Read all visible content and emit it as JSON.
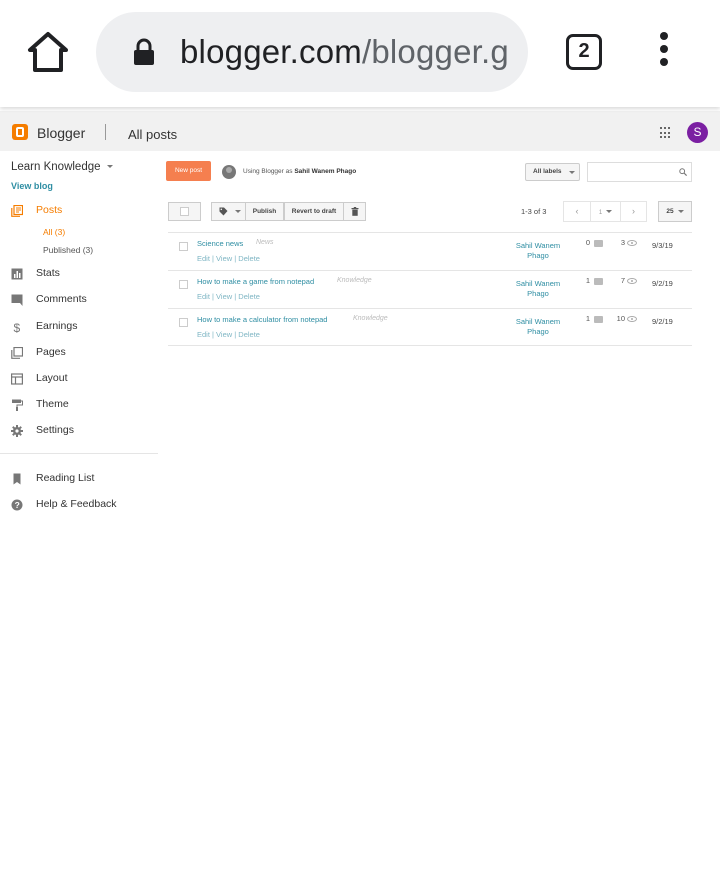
{
  "browser": {
    "url_host": "blogger.com",
    "url_path": "/blogger.g",
    "tab_count": "2"
  },
  "header": {
    "brand": "Blogger",
    "section": "All posts",
    "avatar_letter": "S"
  },
  "sidebar": {
    "blog_name": "Learn Knowledge",
    "view_blog": "View blog",
    "posts_label": "Posts",
    "sub_all": "All (3)",
    "sub_published": "Published (3)",
    "items": [
      {
        "label": "Stats",
        "icon": "stats-icon"
      },
      {
        "label": "Comments",
        "icon": "comment-icon"
      },
      {
        "label": "Earnings",
        "icon": "dollar-icon"
      },
      {
        "label": "Pages",
        "icon": "pages-icon"
      },
      {
        "label": "Layout",
        "icon": "layout-icon"
      },
      {
        "label": "Theme",
        "icon": "paint-roller-icon"
      },
      {
        "label": "Settings",
        "icon": "gear-icon"
      }
    ],
    "bottom_items": [
      {
        "label": "Reading List",
        "icon": "bookmark-icon"
      },
      {
        "label": "Help & Feedback",
        "icon": "help-icon"
      }
    ]
  },
  "main": {
    "new_post": "New post",
    "using_as_prefix": "Using Blogger as",
    "using_as_name": "Sahil Wanem Phago",
    "labels_select": "All labels",
    "toolbar": {
      "publish": "Publish",
      "revert": "Revert to draft"
    },
    "pager": {
      "range": "1-3 of 3",
      "page": "1",
      "per_page": "25"
    },
    "posts": [
      {
        "title": "Science news",
        "label": "News",
        "actions": "Edit | View | Delete",
        "author_1": "Sahil Wanem",
        "author_2": "Phago",
        "comments": "0",
        "views": "3",
        "date": "9/3/19"
      },
      {
        "title": "How to make a game from notepad",
        "label": "Knowledge",
        "actions": "Edit | View | Delete",
        "author_1": "Sahil Wanem",
        "author_2": "Phago",
        "comments": "1",
        "views": "7",
        "date": "9/2/19"
      },
      {
        "title": "How to make a calculator from notepad",
        "label": "Knowledge",
        "actions": "Edit | View | Delete",
        "author_1": "Sahil Wanem",
        "author_2": "Phago",
        "comments": "1",
        "views": "10",
        "date": "9/2/19"
      }
    ]
  },
  "colors": {
    "accent": "#f57d00",
    "link": "#2f8ea3",
    "avatar": "#7b1fa2"
  }
}
